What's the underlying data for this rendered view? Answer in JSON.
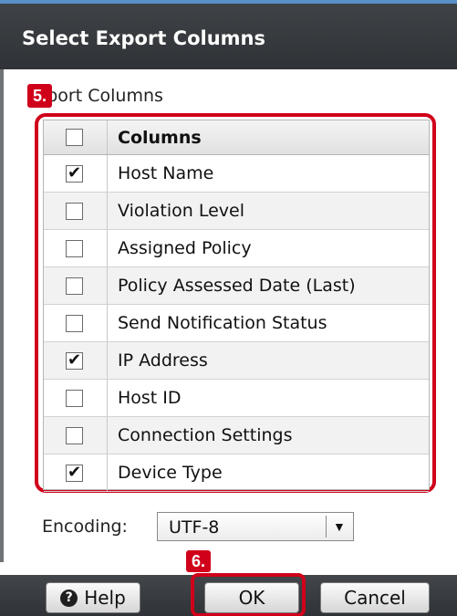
{
  "dialog": {
    "title": "Select Export Columns"
  },
  "export_section": {
    "label": "xport Columns",
    "callout": "5."
  },
  "table": {
    "header": {
      "label": "Columns",
      "checked": false
    },
    "rows": [
      {
        "label": "Host Name",
        "checked": true
      },
      {
        "label": "Violation Level",
        "checked": false
      },
      {
        "label": "Assigned Policy",
        "checked": false
      },
      {
        "label": "Policy Assessed Date (Last)",
        "checked": false
      },
      {
        "label": "Send Notification Status",
        "checked": false
      },
      {
        "label": "IP Address",
        "checked": true
      },
      {
        "label": "Host ID",
        "checked": false
      },
      {
        "label": "Connection Settings",
        "checked": false
      },
      {
        "label": "Device Type",
        "checked": true
      }
    ],
    "check_glyph": "✔"
  },
  "encoding": {
    "label": "Encoding:",
    "value": "UTF-8"
  },
  "footer": {
    "help_label": "Help",
    "ok_label": "OK",
    "cancel_label": "Cancel",
    "ok_callout": "6."
  },
  "colors": {
    "accent": "#d0001a",
    "titlebar": "#3a3d41",
    "stripe": "#f2f2f2"
  }
}
